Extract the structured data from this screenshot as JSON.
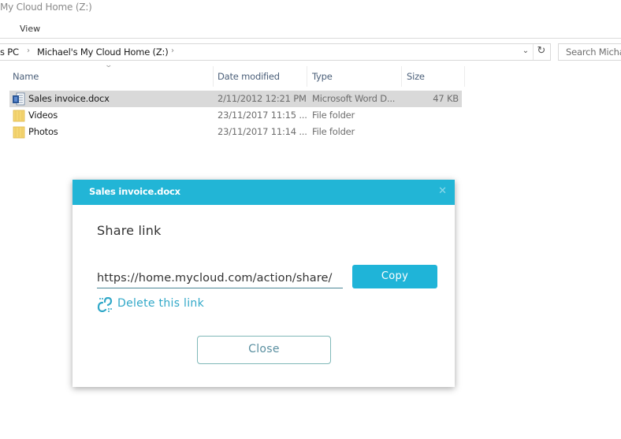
{
  "window": {
    "title": "My Cloud Home (Z:)"
  },
  "ribbon": {
    "tabs": [
      {
        "label": "View"
      }
    ]
  },
  "address_bar": {
    "breadcrumbs": [
      {
        "label": "s PC"
      },
      {
        "label": "Michael's My Cloud Home (Z:)"
      }
    ],
    "separator": "›",
    "dropdown_icon": "chevron-down-icon",
    "refresh_icon": "refresh-icon"
  },
  "search": {
    "placeholder": "Search Micha"
  },
  "file_list": {
    "columns": [
      {
        "key": "name",
        "label": "Name"
      },
      {
        "key": "date",
        "label": "Date modified"
      },
      {
        "key": "type",
        "label": "Type"
      },
      {
        "key": "size",
        "label": "Size"
      }
    ],
    "sort_column": "name",
    "rows": [
      {
        "name": "Sales invoice.docx",
        "date": "2/11/2012 12:21 PM",
        "type": "Microsoft Word D...",
        "size": "47 KB",
        "icon": "word-document-icon",
        "selected": true
      },
      {
        "name": "Videos",
        "date": "23/11/2017 11:15 ...",
        "type": "File folder",
        "size": "",
        "icon": "folder-icon",
        "selected": false
      },
      {
        "name": "Photos",
        "date": "23/11/2017 11:14 ...",
        "type": "File folder",
        "size": "",
        "icon": "folder-icon",
        "selected": false
      }
    ]
  },
  "share_dialog": {
    "title": "Sales invoice.docx",
    "close_icon": "close-icon",
    "heading": "Share link",
    "link_value": "https://home.mycloud.com/action/share/",
    "copy_label": "Copy",
    "delete_label": "Delete this link",
    "close_label": "Close",
    "colors": {
      "accent": "#22b5d6",
      "link_text": "#31a8c8"
    }
  }
}
